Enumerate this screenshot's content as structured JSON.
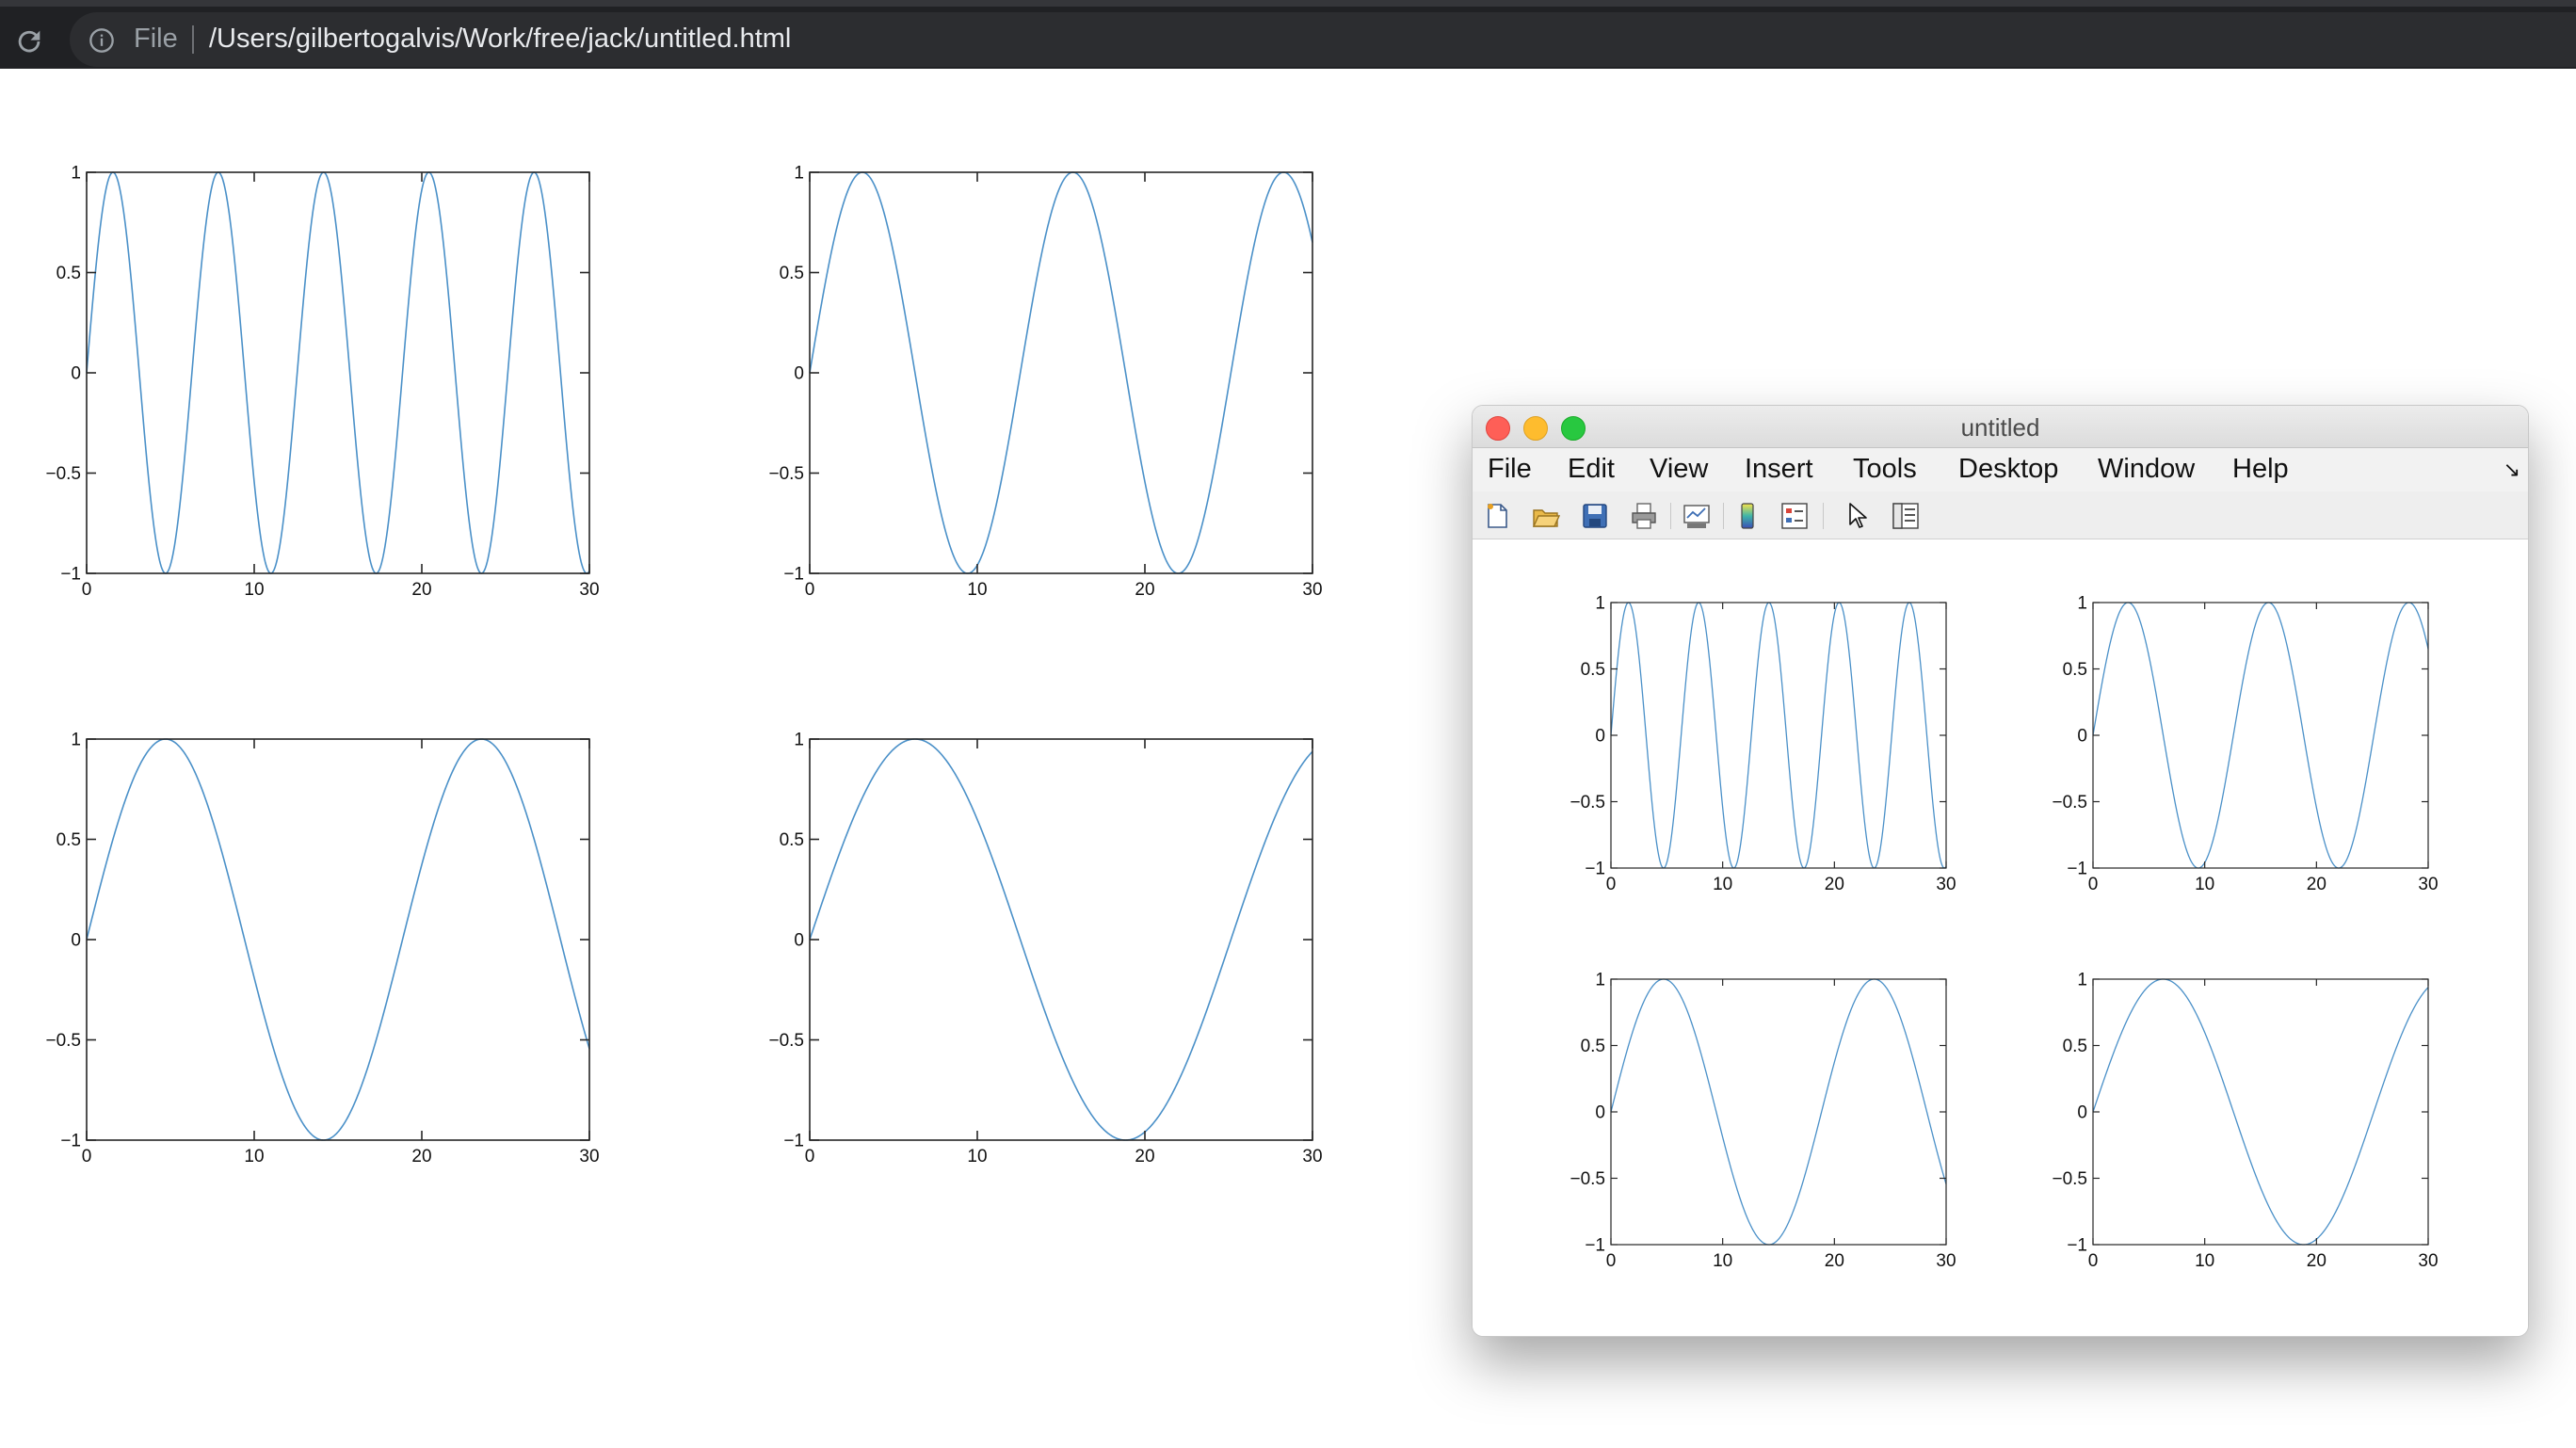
{
  "browser": {
    "scheme_label": "File",
    "url": "/Users/gilbertogalvis/Work/free/jack/untitled.html"
  },
  "figure_window": {
    "title": "untitled",
    "menu": [
      "File",
      "Edit",
      "View",
      "Insert",
      "Tools",
      "Desktop",
      "Window",
      "Help"
    ],
    "toolbar": [
      {
        "name": "new-figure-icon"
      },
      {
        "name": "open-file-icon"
      },
      {
        "name": "save-icon"
      },
      {
        "name": "print-icon"
      },
      {
        "name": "link-plot-icon"
      },
      {
        "name": "insert-colorbar-icon"
      },
      {
        "name": "insert-legend-icon"
      },
      {
        "name": "edit-plot-cursor-icon"
      },
      {
        "name": "property-inspector-icon"
      }
    ]
  },
  "colors": {
    "line": "#4a90c8",
    "axes": "#262626"
  },
  "chart_data": [
    {
      "type": "line",
      "function": "sin(x)",
      "x": [
        0,
        30
      ],
      "xlim": [
        0,
        30
      ],
      "ylim": [
        -1,
        1
      ],
      "xticks": [
        "0",
        "10",
        "20",
        "30"
      ],
      "yticks": [
        "1",
        "0.5",
        "0",
        "−0.5",
        "−1"
      ],
      "grid": false
    },
    {
      "type": "line",
      "function": "sin(x/2)",
      "x": [
        0,
        30
      ],
      "xlim": [
        0,
        30
      ],
      "ylim": [
        -1,
        1
      ],
      "xticks": [
        "0",
        "10",
        "20",
        "30"
      ],
      "yticks": [
        "1",
        "0.5",
        "0",
        "−0.5",
        "−1"
      ],
      "grid": false
    },
    {
      "type": "line",
      "function": "sin(x/3)",
      "x": [
        0,
        30
      ],
      "xlim": [
        0,
        30
      ],
      "ylim": [
        -1,
        1
      ],
      "xticks": [
        "0",
        "10",
        "20",
        "30"
      ],
      "yticks": [
        "1",
        "0.5",
        "0",
        "−0.5",
        "−1"
      ],
      "grid": false
    },
    {
      "type": "line",
      "function": "sin(x/4)",
      "x": [
        0,
        30
      ],
      "xlim": [
        0,
        30
      ],
      "ylim": [
        -1,
        1
      ],
      "xticks": [
        "0",
        "10",
        "20",
        "30"
      ],
      "yticks": [
        "1",
        "0.5",
        "0",
        "−0.5",
        "−1"
      ],
      "grid": false
    }
  ]
}
